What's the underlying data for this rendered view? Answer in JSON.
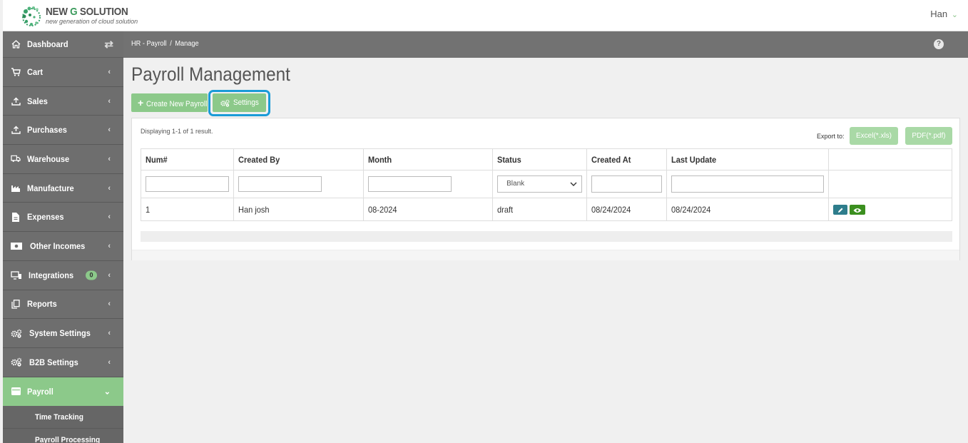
{
  "header": {
    "logo_title_main": "NEW ",
    "logo_title_g": "G",
    "logo_title_rest": " SOLUTION",
    "logo_subtitle": "new generation of cloud solution",
    "user_name": "Han",
    "user_chevron": "⌄"
  },
  "sidebar": {
    "toggle_icon": "⇄",
    "items": [
      {
        "label": "Dashboard",
        "icon": "home-icon",
        "arrow": ""
      },
      {
        "label": "Cart",
        "icon": "cart-icon",
        "arrow": "‹"
      },
      {
        "label": "Sales",
        "icon": "upload-icon",
        "arrow": "‹"
      },
      {
        "label": "Purchases",
        "icon": "upload-icon",
        "arrow": "‹"
      },
      {
        "label": "Warehouse",
        "icon": "truck-icon",
        "arrow": "‹"
      },
      {
        "label": "Manufacture",
        "icon": "factory-icon",
        "arrow": "‹"
      },
      {
        "label": "Expenses",
        "icon": "file-icon",
        "arrow": "‹"
      },
      {
        "label": "Other Incomes",
        "icon": "money-icon",
        "arrow": "‹"
      },
      {
        "label": "Integrations",
        "icon": "devices-icon",
        "arrow": "‹",
        "badge": "0"
      },
      {
        "label": "Reports",
        "icon": "copy-icon",
        "arrow": "‹"
      },
      {
        "label": "System Settings",
        "icon": "cogs-icon",
        "arrow": "‹"
      },
      {
        "label": "B2B Settings",
        "icon": "cogs-icon",
        "arrow": "‹"
      },
      {
        "label": "Payroll",
        "icon": "wallet-icon",
        "arrow": "⌄"
      }
    ],
    "sub_items": [
      {
        "label": "Time Tracking"
      },
      {
        "label": "Payroll Processing"
      }
    ]
  },
  "breadcrumb": {
    "part1": "HR - Payroll",
    "separator": "/",
    "part2": "Manage",
    "help_icon": "?"
  },
  "main": {
    "title": "Payroll Management",
    "create_label": "Create New Payroll",
    "settings_label": "Settings",
    "summary": "Displaying 1-1 of 1 result.",
    "export_label": "Export to:",
    "excel_label": "Excel(*.xls)",
    "pdf_label": "PDF(*.pdf)"
  },
  "table": {
    "columns": [
      "Num#",
      "Created By",
      "Month",
      "Status",
      "Created At",
      "Last Update"
    ],
    "status_filter": "Blank",
    "rows": [
      {
        "num": "1",
        "created_by": "Han josh",
        "month": "08-2024",
        "status": "draft",
        "created_at": "08/24/2024",
        "last_update": "08/24/2024"
      }
    ]
  },
  "colors": {
    "accent": "#8cc98a",
    "sidebar": "#6e6e6e",
    "highlight": "#1a9bd7"
  }
}
